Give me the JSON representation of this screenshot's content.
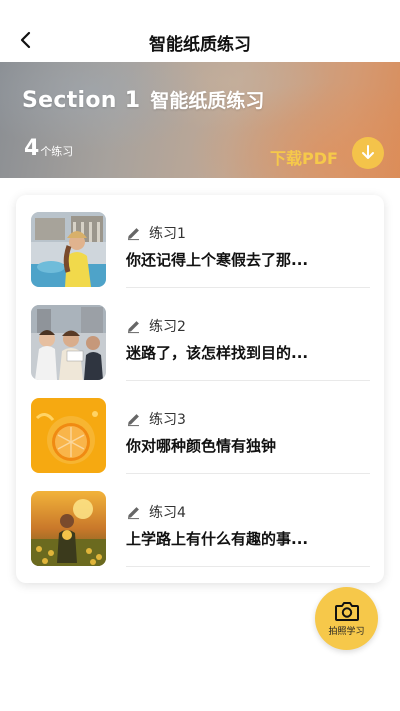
{
  "header": {
    "title": "智能纸质练习"
  },
  "banner": {
    "section_label": "Section 1",
    "section_name": "智能纸质练习",
    "count_number": "4",
    "count_unit": "个练习",
    "download_label": "下载PDF"
  },
  "exercises": [
    {
      "label": "练习1",
      "title": "你还记得上个寒假去了那..."
    },
    {
      "label": "练习2",
      "title": "迷路了，该怎样找到目的..."
    },
    {
      "label": "练习3",
      "title": "你对哪种颜色情有独钟"
    },
    {
      "label": "练习4",
      "title": "上学路上有什么有趣的事..."
    }
  ],
  "fab": {
    "label": "拍照学习"
  },
  "colors": {
    "accent": "#f6c84a",
    "download_text": "#f6c94a"
  },
  "icons": {
    "back": "back-arrow-icon",
    "download": "download-arrow-icon",
    "pencil": "pencil-icon",
    "camera": "camera-icon"
  }
}
